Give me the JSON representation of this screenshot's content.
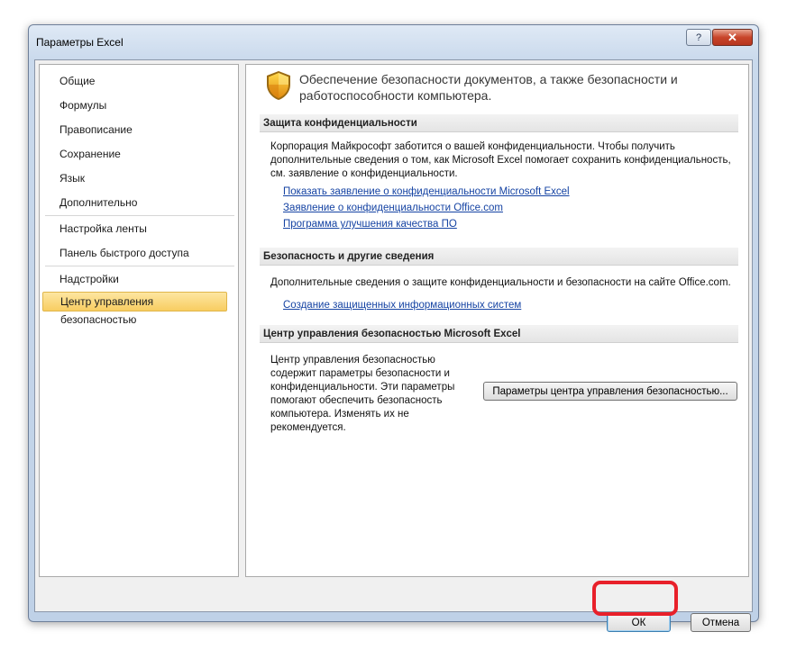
{
  "window": {
    "title": "Параметры Excel",
    "help_icon": "question-icon",
    "close_icon": "close-icon"
  },
  "sidebar": {
    "items": [
      {
        "label": "Общие",
        "selected": false
      },
      {
        "label": "Формулы",
        "selected": false
      },
      {
        "label": "Правописание",
        "selected": false
      },
      {
        "label": "Сохранение",
        "selected": false
      },
      {
        "label": "Язык",
        "selected": false
      },
      {
        "label": "Дополнительно",
        "selected": false
      },
      {
        "label": "Настройка ленты",
        "selected": false
      },
      {
        "label": "Панель быстрого доступа",
        "selected": false
      },
      {
        "label": "Надстройки",
        "selected": false
      },
      {
        "label": "Центр управления безопасностью",
        "selected": true
      }
    ]
  },
  "main": {
    "header_icon": "shield-icon",
    "header_text": "Обеспечение безопасности документов, а также безопасности и работоспособности компьютера.",
    "privacy": {
      "title": "Защита конфиденциальности",
      "text": "Корпорация Майкрософт заботится о вашей конфиденциальности. Чтобы получить дополнительные сведения о том, как Microsoft Excel помогает сохранить конфиденциальность, см. заявление о конфиденциальности.",
      "links": [
        "Показать заявление о конфиденциальности Microsoft Excel",
        "Заявление о конфиденциальности Office.com",
        "Программа улучшения качества ПО"
      ]
    },
    "security": {
      "title": "Безопасность и другие сведения",
      "text": "Дополнительные сведения о защите конфиденциальности и безопасности на сайте Office.com.",
      "link": "Создание защищенных информационных систем"
    },
    "trust_center": {
      "title": "Центр управления безопасностью Microsoft Excel",
      "text": "Центр управления безопасностью содержит параметры безопасности и конфиденциальности. Эти параметры помогают обеспечить безопасность компьютера. Изменять их не рекомендуется.",
      "button": "Параметры центра управления безопасностью..."
    }
  },
  "footer": {
    "ok": "ОК",
    "cancel": "Отмена"
  },
  "colors": {
    "selected_bg": "#f8cd61",
    "link": "#1543a3",
    "highlight": "#e8202a"
  }
}
